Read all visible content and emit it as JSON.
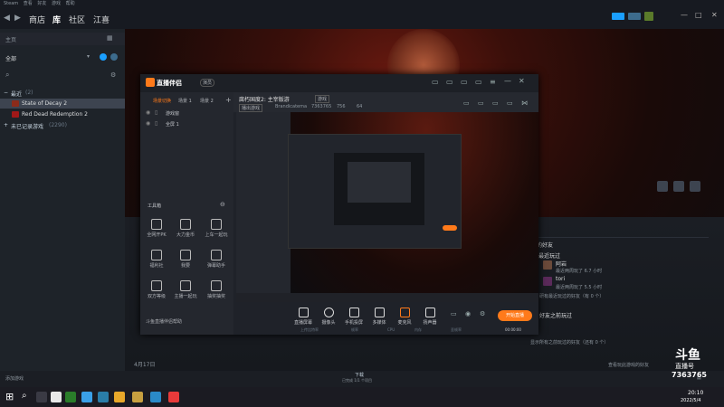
{
  "steam": {
    "menubar": [
      "Steam",
      "查看",
      "好友",
      "游戏",
      "帮助"
    ],
    "nav": {
      "store": "商店",
      "library": "库",
      "community": "社区",
      "user": "江喜"
    },
    "window_controls": {
      "minimize": "—",
      "maximize": "□",
      "close": "✕"
    },
    "sidebar": {
      "home": "主页",
      "filter": "全部",
      "section_recent": "最近",
      "recent_count": "(2)",
      "games": [
        {
          "name": "State of Decay 2",
          "color": "#8b2b1a"
        },
        {
          "name": "Red Dead Redemption 2",
          "color": "#a01818"
        }
      ],
      "section_uncategorized": "未已记录游戏",
      "uncategorized_count": "(2290)",
      "add_game": "添加游戏"
    },
    "hero": {
      "date": "4月17日",
      "friends_heading": "的好友",
      "recent_heading": "最近玩过",
      "friends": [
        {
          "name": "阿岩",
          "status": "最近两周玩了 6.7 小时"
        },
        {
          "name": "tori",
          "status": "最近两周玩了 5.5 小时"
        }
      ],
      "friends_want": "研有最近玩过的好友（有 0 个）",
      "section2": "好友之前玩过",
      "friends_before": "显示所有之前玩过的好友（还有 0 个）",
      "view_all": "查看玩此游戏的好友"
    },
    "downloads": {
      "label": "下载",
      "detail": "已完成 1/1 个项目"
    }
  },
  "douyu": {
    "logo": "直播伴侣",
    "badge": "演员",
    "tabs": [
      "场景切换",
      "场景 1",
      "场景 2"
    ],
    "sources": [
      "游戏窗",
      "全屏 1"
    ],
    "room_title": "腐朽国度2: 主宰版游",
    "room_tag": "游戏",
    "room_sub": [
      "播出游戏",
      "Brandicatema",
      "7363765",
      "756",
      "64"
    ],
    "toolbox": "工具箱",
    "tools": [
      "全网开PK",
      "大力金币",
      "上车一起玩",
      "福利社",
      "我要",
      "弹幕助手",
      "双方等级",
      "主播一起玩",
      "抽奖抽奖",
      "斗鱼直播伴侣帮助"
    ],
    "bottom_controls": [
      "直播屏幕",
      "摄像头",
      "手机投屏",
      "多媒体",
      "麦克风",
      "扬声器"
    ],
    "start_button": "开始直播",
    "stats": [
      "上传比特率",
      "帧率",
      "CPU",
      "内存",
      "丢帧率",
      "00:00:00"
    ]
  },
  "watermark": {
    "brand": "斗鱼",
    "room": "直播号",
    "room_id": "7363765"
  },
  "taskbar": {
    "time": "20:10",
    "date": "2022/5/4",
    "icons": [
      "#3a3a44",
      "#e8e8e8",
      "#2a7d2a",
      "#3aa0e8",
      "#2a7da8",
      "#e8a82a",
      "#c8a040",
      "#2a8ac8",
      "#e83a3a"
    ]
  },
  "colors": {
    "accent": "#ff7a1a",
    "steam_blue": "#1a9fff",
    "hero_red": "#6b1a10"
  }
}
